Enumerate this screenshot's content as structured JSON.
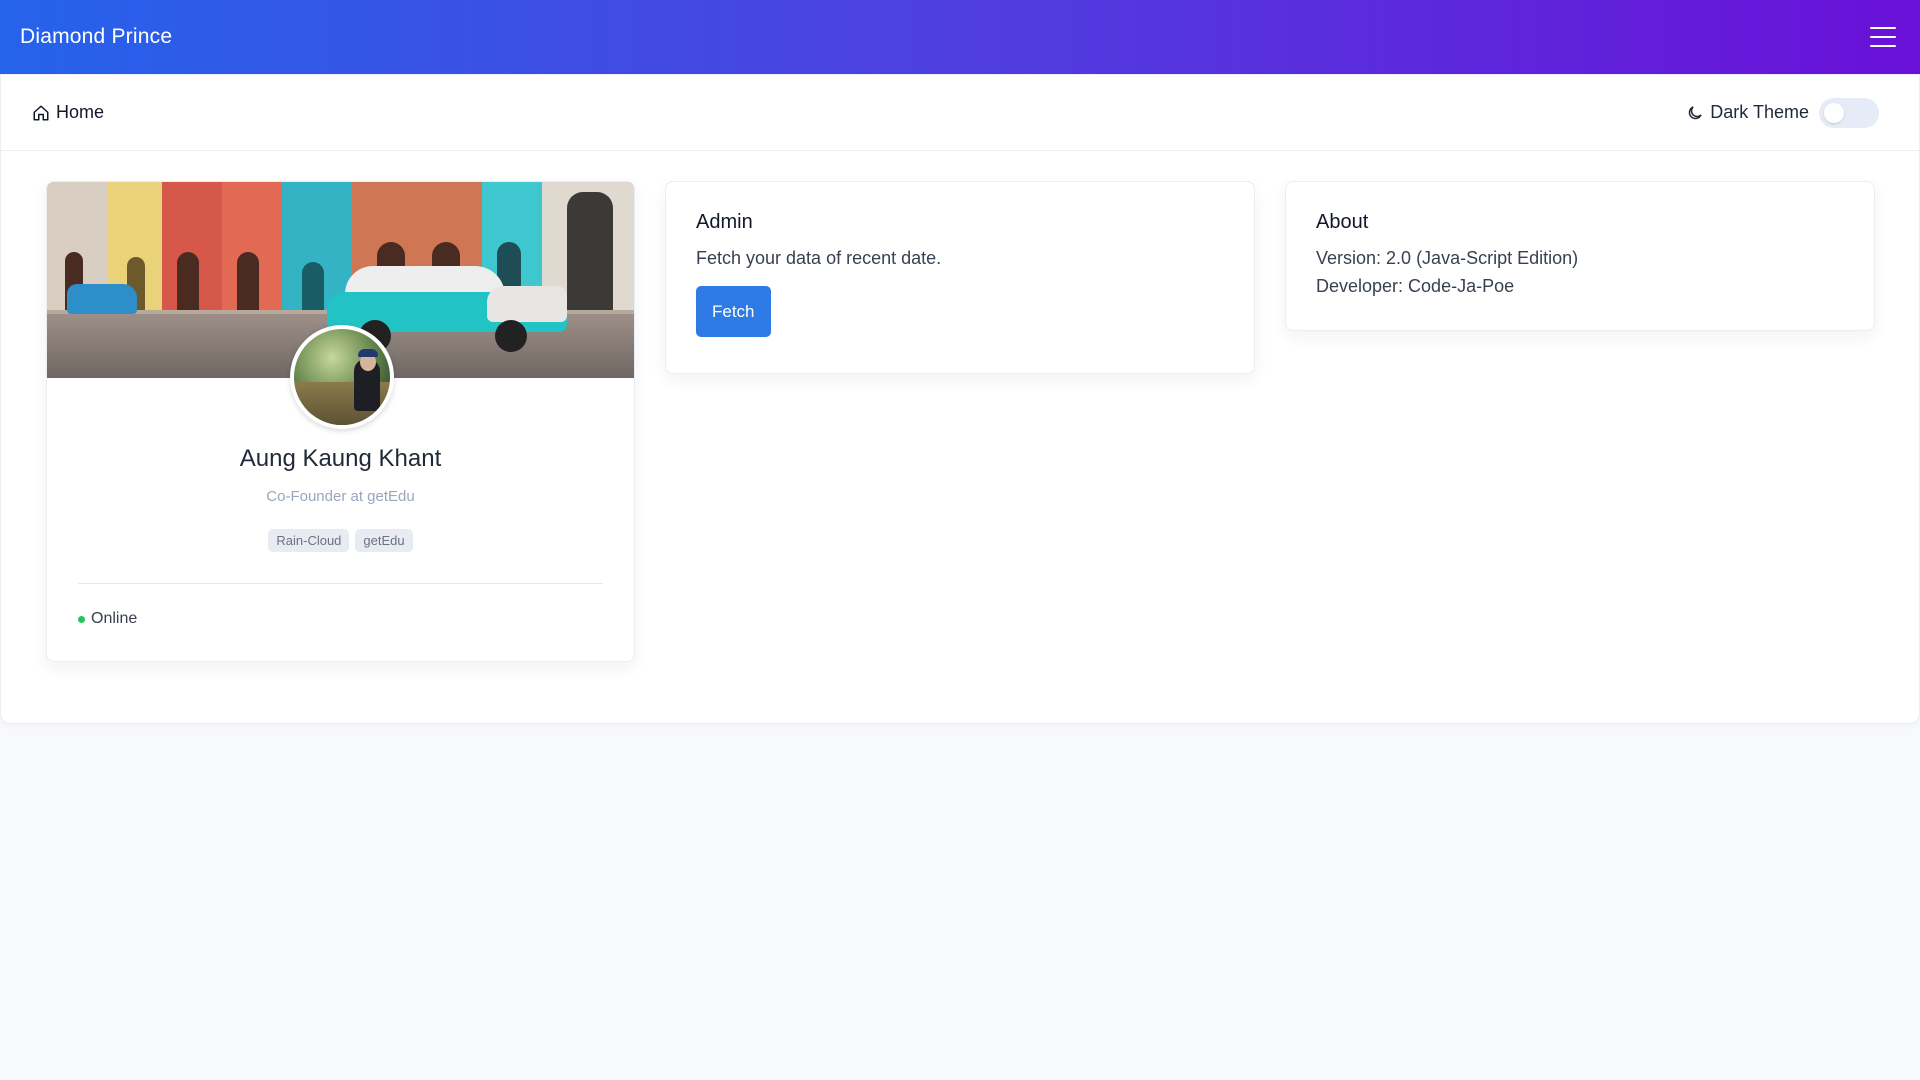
{
  "navbar": {
    "brand": "Diamond Prince",
    "menu_icon": "hamburger-icon"
  },
  "subheader": {
    "home_label": "Home",
    "home_icon": "home-icon",
    "theme_label": "Dark Theme",
    "theme_icon": "moon-icon",
    "dark_theme_enabled": false
  },
  "profile": {
    "name": "Aung Kaung Khant",
    "role": "Co-Founder at getEdu",
    "tags": [
      "Rain-Cloud",
      "getEdu"
    ],
    "status": "Online",
    "status_color": "#22c55e"
  },
  "admin": {
    "title": "Admin",
    "description": "Fetch your data of recent date.",
    "button_label": "Fetch"
  },
  "about": {
    "title": "About",
    "version": "Version: 2.0 (Java-Script Edition)",
    "developer": "Developer: Code-Ja-Poe"
  },
  "colors": {
    "navbar_start": "#2563eb",
    "navbar_end": "#6a11d8",
    "button": "#2f7be5"
  }
}
